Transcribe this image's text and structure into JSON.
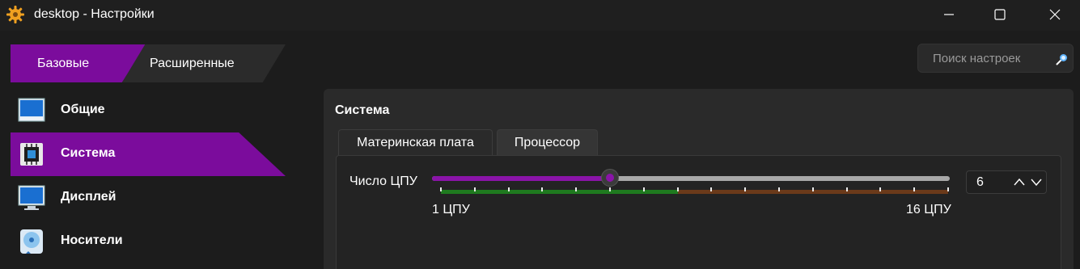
{
  "window": {
    "title": "desktop - Настройки",
    "app_icon": "gear-icon",
    "controls": [
      "minimize-icon",
      "maximize-icon",
      "close-icon"
    ]
  },
  "mode_tabs": [
    {
      "label": "Базовые",
      "selected": true
    },
    {
      "label": "Расширенные",
      "selected": false
    }
  ],
  "search": {
    "placeholder": "Поиск настроек",
    "icon": "search-icon"
  },
  "sidebar": {
    "items": [
      {
        "label": "Общие",
        "icon": "monitor-general-icon",
        "selected": false
      },
      {
        "label": "Система",
        "icon": "chip-icon",
        "selected": true
      },
      {
        "label": "Дисплей",
        "icon": "display-icon",
        "selected": false
      },
      {
        "label": "Носители",
        "icon": "storage-disk-icon",
        "selected": false
      }
    ]
  },
  "panel": {
    "title": "Система",
    "tabs": [
      {
        "label": "Материнская плата",
        "selected": false
      },
      {
        "label": "Процессор",
        "selected": true
      }
    ],
    "cpu": {
      "label": "Число ЦПУ",
      "min": 1,
      "max": 16,
      "value": 6,
      "value_text": "6",
      "min_label": "1 ЦПУ",
      "max_label": "16 ЦПУ",
      "recommended_max": 8
    }
  },
  "colors": {
    "accent": "#7b0c9c",
    "slider_fill": "#8a14a8",
    "scale_ok": "#1f7a1f",
    "scale_warn": "#6b3a1a",
    "background": "#1c1c1c",
    "panel": "#2a2a2a"
  }
}
